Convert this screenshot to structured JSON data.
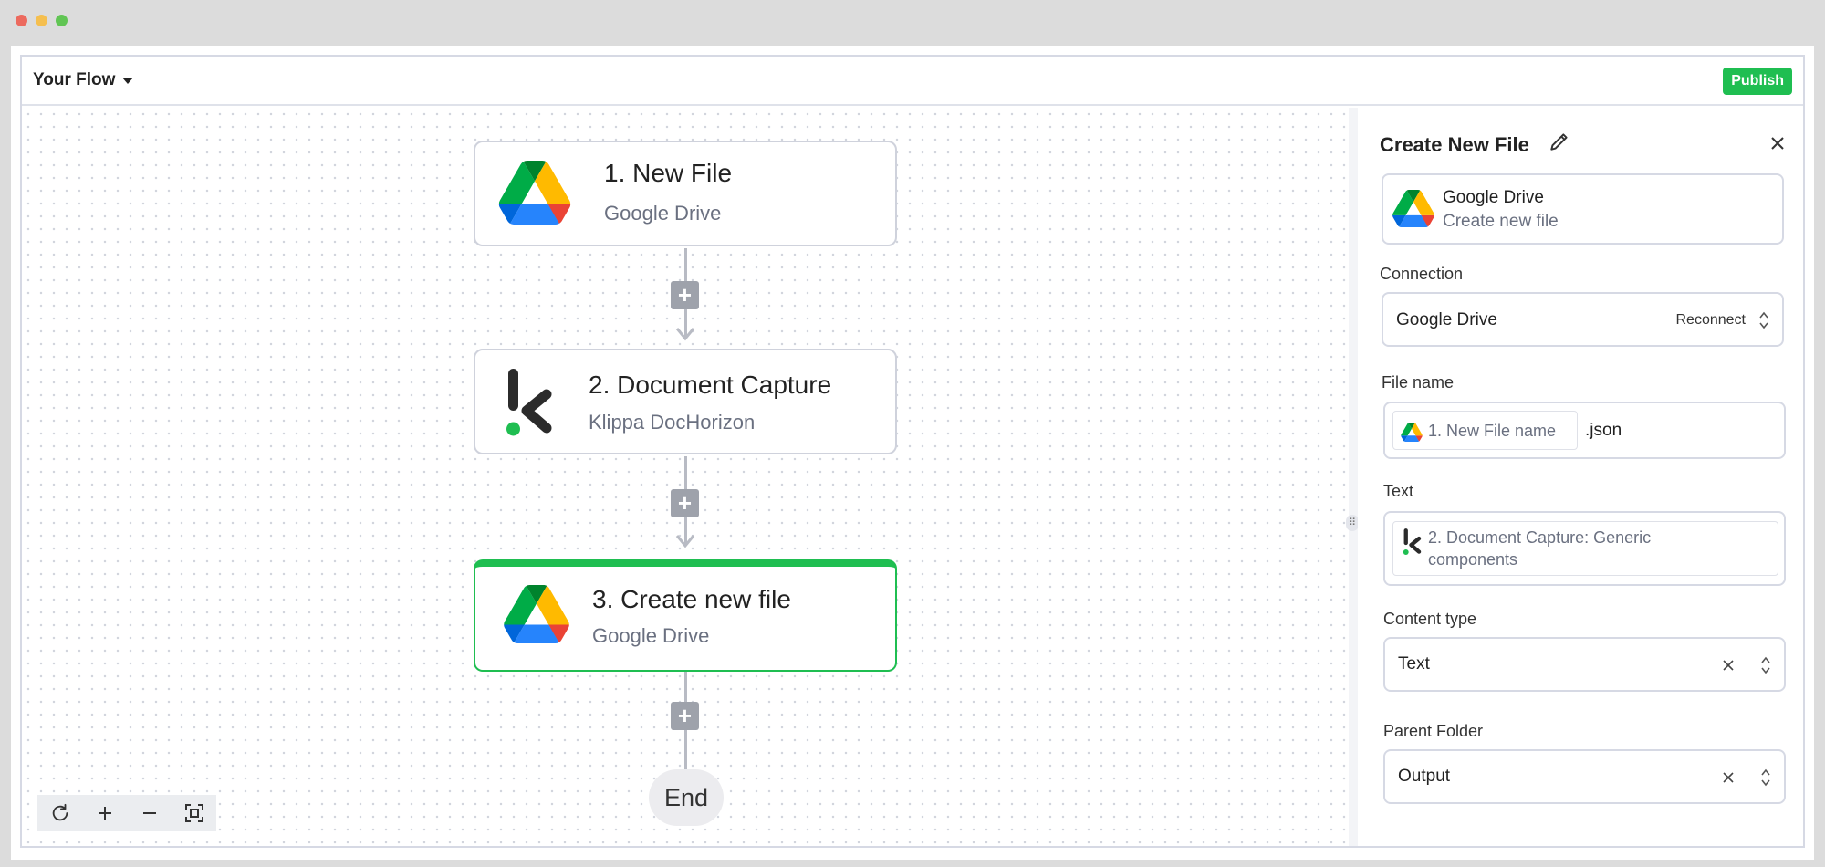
{
  "window": {
    "dots": [
      "#ec6a5e",
      "#f5bf4f",
      "#61c554"
    ]
  },
  "header": {
    "title": "Your Flow",
    "publish_label": "Publish",
    "accent": "#1fbe51"
  },
  "flow": {
    "nodes": [
      {
        "title": "1. New File",
        "subtitle": "Google Drive",
        "icon": "google-drive-icon"
      },
      {
        "title": "2. Document Capture",
        "subtitle": "Klippa DocHorizon",
        "icon": "klippa-icon"
      },
      {
        "title": "3. Create new file",
        "subtitle": "Google Drive",
        "icon": "google-drive-icon",
        "selected": true
      }
    ],
    "end_label": "End"
  },
  "zoom_controls": [
    "refresh-icon",
    "zoom-in-icon",
    "zoom-out-icon",
    "fit-screen-icon"
  ],
  "panel": {
    "title": "Create New File",
    "app_name": "Google Drive",
    "action": "Create new file",
    "connection_label": "Connection",
    "connection_value": "Google Drive",
    "reconnect_label": "Reconnect",
    "file_name_label": "File name",
    "file_name_chip": "1. New File name",
    "file_name_suffix": ".json",
    "text_label": "Text",
    "text_chip_line1": "2. Document Capture: Generic",
    "text_chip_line2": "components",
    "content_type_label": "Content type",
    "content_type_value": "Text",
    "parent_folder_label": "Parent Folder",
    "parent_folder_value": "Output"
  }
}
